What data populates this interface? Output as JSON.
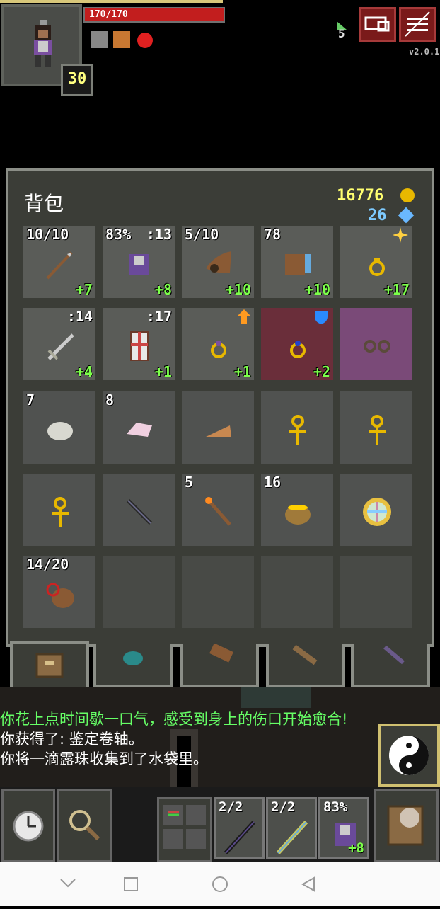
{
  "status": {
    "hp_text": "170/170",
    "hp_fraction": 1.0,
    "level": "30",
    "depth": "5",
    "version": "v2.0.1"
  },
  "inventory": {
    "title": "背包",
    "gold": "16776",
    "energy": "26",
    "rows": [
      [
        {
          "tl": "10/10",
          "tr": "",
          "br": "+7",
          "icon": "spear-icon"
        },
        {
          "tl": "83%",
          "tr": ":13",
          "br": "+8",
          "icon": "armor-icon"
        },
        {
          "tl": "5/10",
          "tr": "",
          "br": "+10",
          "icon": "horn-of-plenty-icon"
        },
        {
          "tl": "78",
          "tr": "",
          "br": "+10",
          "icon": "alchemy-chest-icon"
        },
        {
          "tl": "",
          "tr": "",
          "br": "+17",
          "icon": "ring-icon"
        }
      ],
      [
        {
          "tl": "",
          "tr": ":14",
          "br": "+4",
          "icon": "sword-icon"
        },
        {
          "tl": "",
          "tr": ":17",
          "br": "+1",
          "icon": "shield-icon"
        },
        {
          "tl": "",
          "tr": "",
          "br": "+1",
          "icon": "ring-upgrade-icon"
        },
        {
          "tl": "",
          "tr": "",
          "br": "+2",
          "icon": "ring-blue-icon"
        },
        {
          "tl": "",
          "tr": "",
          "br": "",
          "icon": "goggles-icon"
        }
      ],
      [
        {
          "tl": "7",
          "tr": "",
          "br": "",
          "icon": "stone-icon"
        },
        {
          "tl": "8",
          "tr": "",
          "br": "",
          "icon": "crystal-icon"
        },
        {
          "tl": "",
          "tr": "",
          "br": "",
          "icon": "pie-icon"
        },
        {
          "tl": "",
          "tr": "",
          "br": "",
          "icon": "ankh-icon"
        },
        {
          "tl": "",
          "tr": "",
          "br": "",
          "icon": "ankh-icon"
        }
      ],
      [
        {
          "tl": "",
          "tr": "",
          "br": "",
          "icon": "ankh-icon"
        },
        {
          "tl": "",
          "tr": "",
          "br": "",
          "icon": "dagger-icon"
        },
        {
          "tl": "5",
          "tr": "",
          "br": "",
          "icon": "torch-icon"
        },
        {
          "tl": "16",
          "tr": "",
          "br": "",
          "icon": "honey-pot-icon"
        },
        {
          "tl": "",
          "tr": "",
          "br": "",
          "icon": "holy-seal-icon"
        }
      ],
      [
        {
          "tl": "14/20",
          "tr": "",
          "br": "",
          "icon": "waterskin-icon"
        },
        {
          "tl": "",
          "tr": "",
          "br": "",
          "icon": ""
        },
        {
          "tl": "",
          "tr": "",
          "br": "",
          "icon": ""
        },
        {
          "tl": "",
          "tr": "",
          "br": "",
          "icon": ""
        },
        {
          "tl": "",
          "tr": "",
          "br": "",
          "icon": ""
        }
      ]
    ]
  },
  "log": [
    {
      "text": "你花上点时间歇一口气，感受到身上的伤口开始愈合!",
      "color": "green"
    },
    {
      "text": "你获得了: 鉴定卷轴。",
      "color": "white"
    },
    {
      "text": "你将一滴露珠收集到了水袋里。",
      "color": "white"
    }
  ],
  "quickslots": [
    {
      "label": "2/2",
      "bonus": "",
      "icon": "wand-icon"
    },
    {
      "label": "2/2",
      "bonus": "",
      "icon": "wand-icon"
    },
    {
      "label": "83%",
      "bonus": "+8",
      "icon": "armor-icon"
    }
  ]
}
